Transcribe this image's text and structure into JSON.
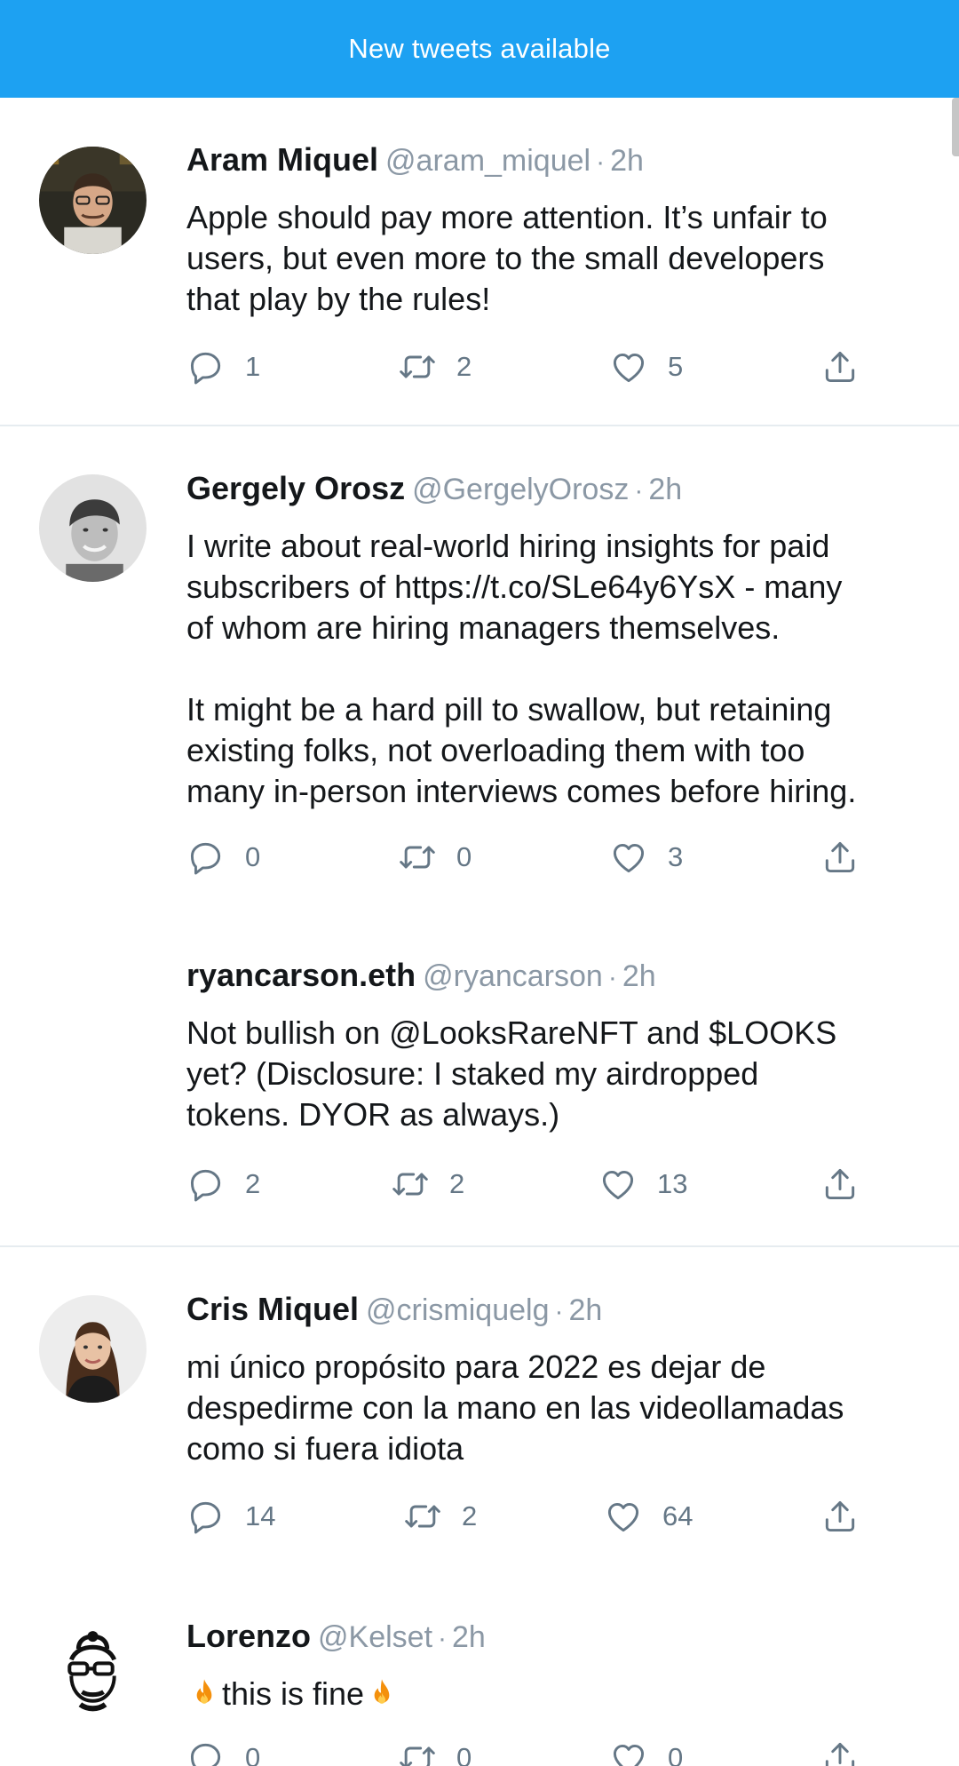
{
  "banner": {
    "label": "New tweets available"
  },
  "colors": {
    "accent": "#1da1f2",
    "muted": "#8b98a5",
    "icon": "#657786"
  },
  "icons": {
    "reply": "reply-icon",
    "retweet": "retweet-icon",
    "like": "heart-icon",
    "share": "share-icon",
    "fire": "fire-emoji"
  },
  "tweets": [
    {
      "name": "Aram Miquel",
      "handle": "@aram_miquel",
      "separator": "·",
      "time": "2h",
      "text": "Apple should pay more attention. It’s unfair to\nusers, but even more to the small developers\nthat play by the rules!",
      "replies": "1",
      "retweets": "2",
      "likes": "5"
    },
    {
      "name": "Gergely Orosz",
      "handle": "@GergelyOrosz",
      "separator": "·",
      "time": "2h",
      "text": "I write about real-world hiring insights for paid\nsubscribers of https://t.co/SLe64y6YsX - many\nof whom are hiring managers themselves.\n\nIt might be a hard pill to swallow, but retaining\nexisting folks, not overloading them with too\nmany in-person interviews comes before hiring.",
      "replies": "0",
      "retweets": "0",
      "likes": "3"
    },
    {
      "name": "ryancarson.eth",
      "handle": "@ryancarson",
      "separator": "·",
      "time": "2h",
      "text": "Not bullish on @LooksRareNFT and $LOOKS\nyet? (Disclosure: I staked my airdropped\ntokens. DYOR as always.)",
      "replies": "2",
      "retweets": "2",
      "likes": "13"
    },
    {
      "name": "Cris Miquel",
      "handle": "@crismiquelg",
      "separator": "·",
      "time": "2h",
      "text": "mi único propósito para 2022 es dejar de\ndespedirme con la mano en las videollamadas\ncomo si fuera idiota",
      "replies": "14",
      "retweets": "2",
      "likes": "64"
    },
    {
      "name": "Lorenzo",
      "handle": "@Kelset",
      "separator": "·",
      "time": "2h",
      "text": "this is fine",
      "replies": "0",
      "retweets": "0",
      "likes": "0"
    }
  ]
}
